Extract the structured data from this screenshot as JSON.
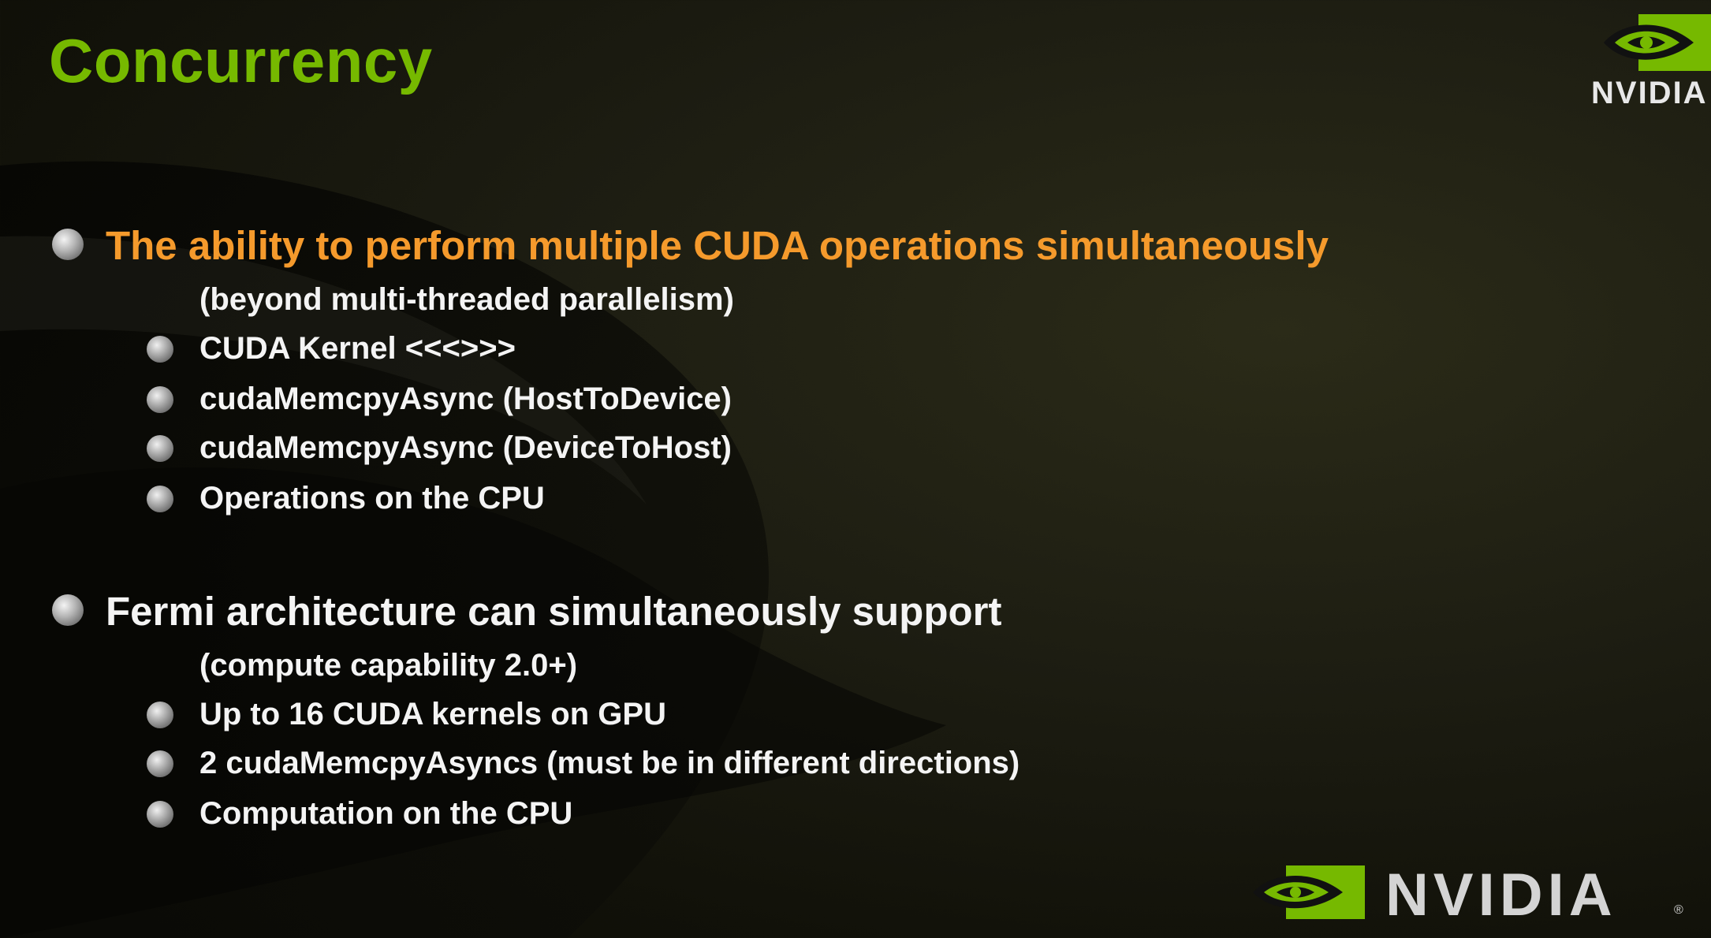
{
  "slide": {
    "title": "Concurrency",
    "sections": [
      {
        "heading": "The ability to perform multiple CUDA operations simultaneously",
        "note": "(beyond multi-threaded parallelism)",
        "items": [
          "CUDA Kernel <<<>>>",
          "cudaMemcpyAsync (HostToDevice)",
          "cudaMemcpyAsync (DeviceToHost)",
          "Operations on the CPU"
        ]
      },
      {
        "heading": "Fermi architecture can simultaneously support",
        "note": "(compute capability 2.0+)",
        "items": [
          "Up to 16 CUDA kernels on GPU",
          "2 cudaMemcpyAsyncs (must be in different directions)",
          "Computation on the CPU"
        ]
      }
    ]
  },
  "branding": {
    "logo_top_text": "NVIDIA",
    "logo_bottom_text": "NVIDIA",
    "registered_mark": "®",
    "brand_green": "#76b900",
    "accent_orange": "#f59a2c",
    "text_white": "#f4f4f4"
  }
}
